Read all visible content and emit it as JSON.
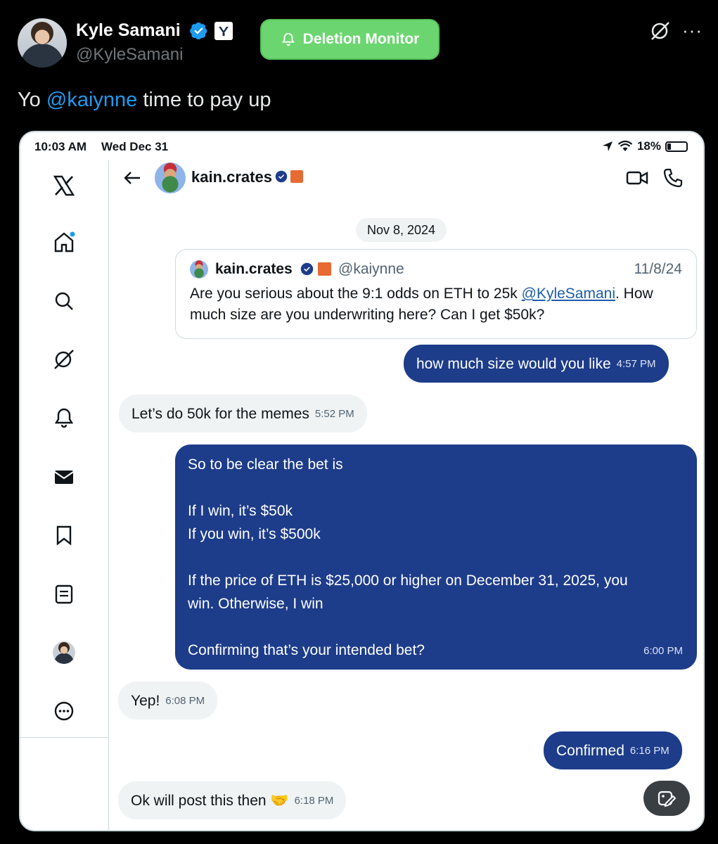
{
  "tweet": {
    "author_name": "Kyle Samani",
    "author_handle": "@KyleSamani",
    "deletion_monitor_label": "Deletion Monitor",
    "text_prefix": "Yo ",
    "mention": "@kaiynne",
    "text_suffix": " time to pay up",
    "more_label": "···"
  },
  "screenshot": {
    "status": {
      "time": "10:03 AM",
      "date": "Wed Dec 31",
      "battery": "18%"
    },
    "conversation": {
      "name": "kain.crates"
    },
    "date_divider": "Nov 8, 2024",
    "quote": {
      "name": "kain.crates",
      "handle": "@kaiynne",
      "date": "11/8/24",
      "text_before": "Are you serious about the 9:1 odds on ETH to 25k ",
      "link": "@KyleSamani",
      "text_after": ". How much size are you underwriting here? Can I get $50k?"
    },
    "messages": [
      {
        "text": "how much size would you like",
        "time": "4:57 PM"
      },
      {
        "text": "Let’s do 50k for the memes",
        "time": "5:52 PM"
      },
      {
        "lines": [
          "So to be clear the bet is",
          "",
          "If I win, it’s $50k",
          "If you win, it’s $500k",
          "",
          "If the price of ETH is $25,000 or higher on December 31, 2025, you",
          "win. Otherwise, I win",
          "",
          "Confirming that’s your intended bet?"
        ],
        "time": "6:00 PM"
      },
      {
        "text": "Yep!",
        "time": "6:08 PM"
      },
      {
        "text": "Confirmed",
        "time": "6:16 PM"
      },
      {
        "text": "Ok will post this then 🤝",
        "time": "6:18 PM"
      }
    ]
  },
  "colors": {
    "accent": "#1d9bf0",
    "deletion_green": "#6bd66f",
    "dm_outgoing": "#1d3c8a"
  }
}
